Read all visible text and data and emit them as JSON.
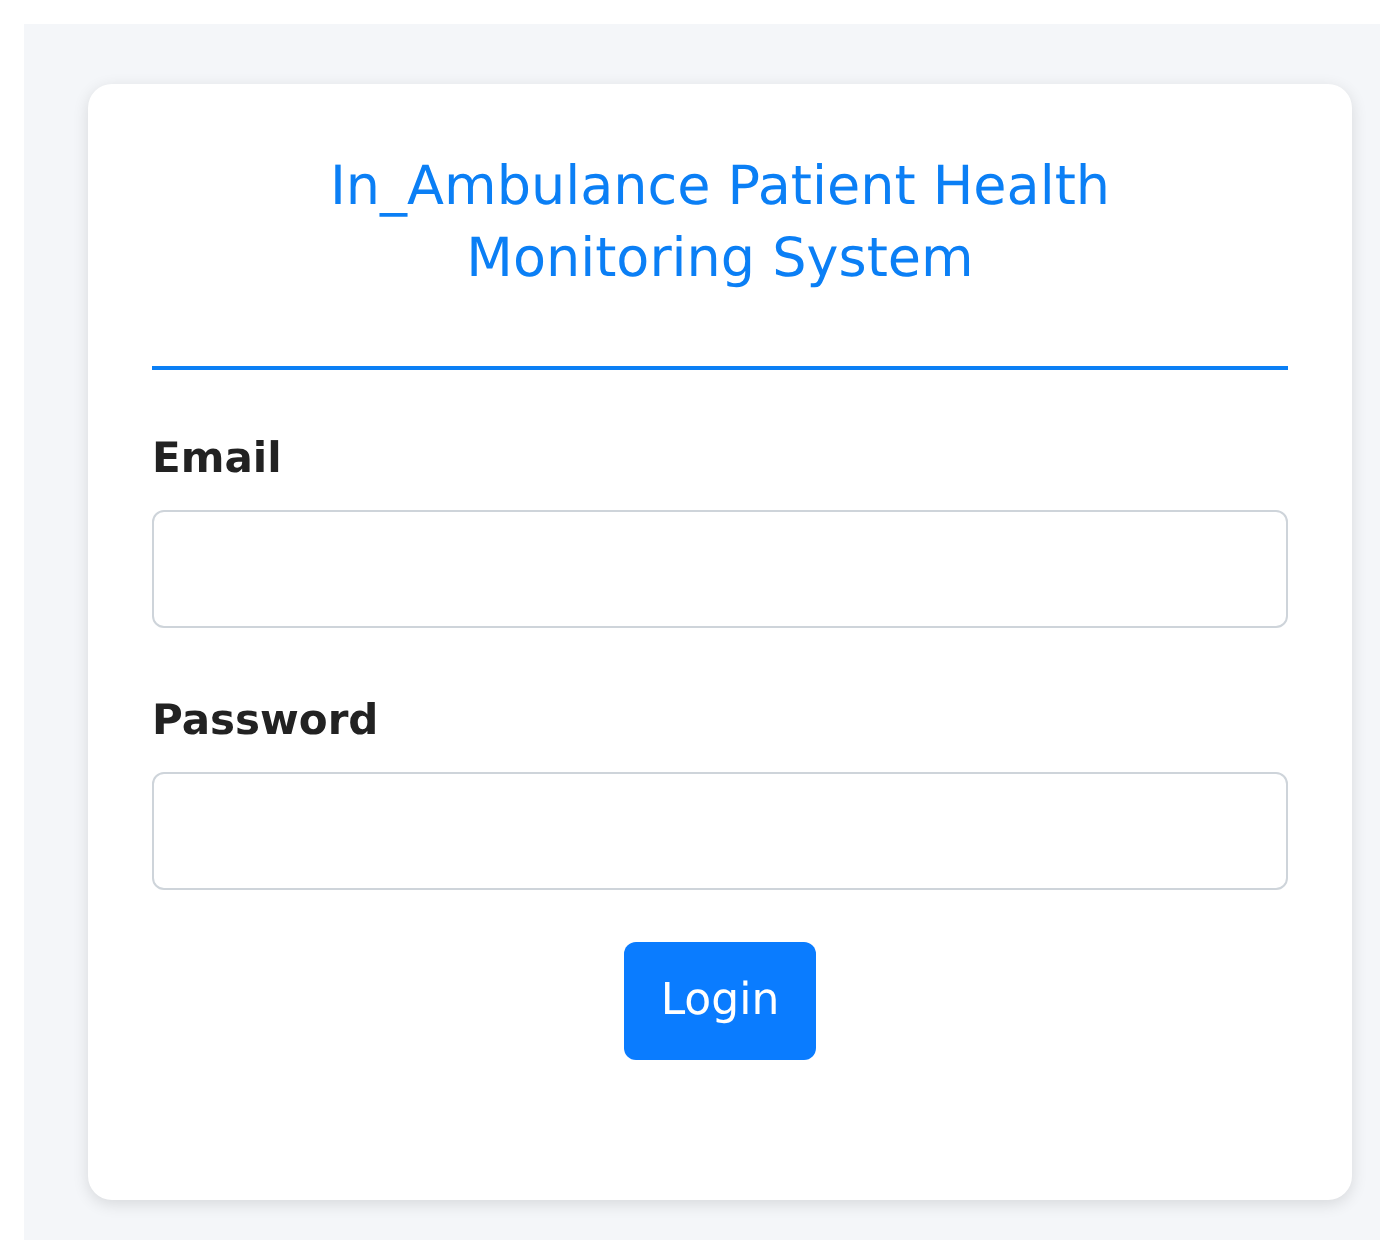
{
  "title": "In_Ambulance Patient Health Monitoring System",
  "fields": [
    {
      "label": "Email"
    },
    {
      "label": "Password"
    }
  ],
  "button": "Login"
}
